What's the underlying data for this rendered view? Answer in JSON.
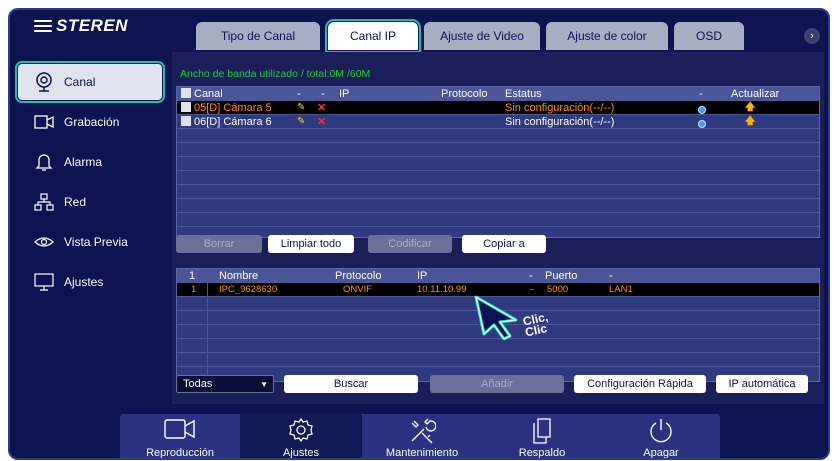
{
  "brand": {
    "name": "STEREN"
  },
  "tabs": [
    {
      "label": "Tipo de Canal",
      "active": false
    },
    {
      "label": "Canal IP",
      "active": true
    },
    {
      "label": "Ajuste de Video",
      "active": false
    },
    {
      "label": "Ajuste de color",
      "active": false
    },
    {
      "label": "OSD",
      "active": false
    }
  ],
  "tabs_next_icon": "›",
  "sidebar": {
    "items": [
      {
        "label": "Canal",
        "icon": "webcam-icon",
        "active": true
      },
      {
        "label": "Grabación",
        "icon": "video-camera-icon",
        "active": false
      },
      {
        "label": "Alarma",
        "icon": "bell-icon",
        "active": false
      },
      {
        "label": "Red",
        "icon": "network-icon",
        "active": false
      },
      {
        "label": "Vista Previa",
        "icon": "eye-icon",
        "active": false
      },
      {
        "label": "Ajustes",
        "icon": "monitor-icon",
        "active": false
      }
    ]
  },
  "bandwidth": "Ancho de banda utilizado / total:0M /60M",
  "channel_table": {
    "headers": {
      "channel": "Canal",
      "dash1": "-",
      "dash2": "-",
      "ip": "IP",
      "protocol": "Protocolo",
      "status": "Estatus",
      "dash3": "-",
      "update": "Actualizar"
    },
    "rows": [
      {
        "channel": "05[D] Cámara 5",
        "edit_icon": "✎",
        "delete_icon": "✕",
        "status": "Sin configuración(--/--)",
        "selected": true
      },
      {
        "channel": "06[D] Cámara 6",
        "edit_icon": "✎",
        "delete_icon": "✕",
        "status": "Sin configuración(--/--)",
        "selected": false
      }
    ]
  },
  "actions": {
    "delete": "Borrar",
    "clear_all": "Limpiar todo",
    "modify": "Codificar",
    "copy_to": "Copiar a"
  },
  "device_table": {
    "headers": {
      "num": "1",
      "name": "Nombre",
      "protocol": "Protocolo",
      "ip": "IP",
      "dash": "-",
      "port": "Puerto",
      "dash2": "-"
    },
    "rows": [
      {
        "num": "1",
        "name": "IPC_9628630",
        "protocol": "ONVIF",
        "ip": "10.11.10.99",
        "dash": "–",
        "port": "5000",
        "iface": "LAN1"
      }
    ]
  },
  "bottom_controls": {
    "filter_value": "Todas",
    "search": "Buscar",
    "add": "Añadir",
    "quick_config": "Configuración Rápida",
    "auto_ip": "IP automática"
  },
  "bottom_nav": [
    {
      "label": "Reproducción",
      "icon": "video-camera-icon",
      "active": false
    },
    {
      "label": "Ajustes",
      "icon": "gear-icon",
      "active": true
    },
    {
      "label": "Mantenimiento",
      "icon": "tools-icon",
      "active": false
    },
    {
      "label": "Respaldo",
      "icon": "copy-icon",
      "active": false
    },
    {
      "label": "Apagar",
      "icon": "power-icon",
      "active": false
    }
  ],
  "annotation": {
    "line1": "Clic,",
    "line2": "Clic"
  },
  "colors": {
    "background": "#0c1350",
    "accent": "#2fb8b0",
    "bandwidth_text": "#19d128",
    "selected_text": "#ff8a00"
  }
}
